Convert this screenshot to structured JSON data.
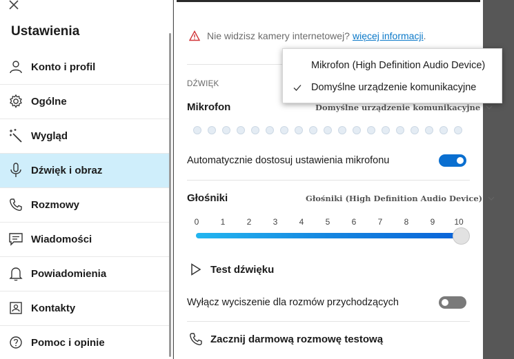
{
  "sidebar": {
    "title": "Ustawienia",
    "items": [
      {
        "label": "Konto i profil",
        "icon": "person-icon"
      },
      {
        "label": "Ogólne",
        "icon": "gear-icon"
      },
      {
        "label": "Wygląd",
        "icon": "magic-wand-icon"
      },
      {
        "label": "Dźwięk i obraz",
        "icon": "microphone-icon",
        "selected": true
      },
      {
        "label": "Rozmowy",
        "icon": "phone-icon"
      },
      {
        "label": "Wiadomości",
        "icon": "chat-icon"
      },
      {
        "label": "Powiadomienia",
        "icon": "bell-icon"
      },
      {
        "label": "Kontakty",
        "icon": "contact-card-icon"
      },
      {
        "label": "Pomoc i opinie",
        "icon": "help-icon"
      }
    ]
  },
  "camera": {
    "warning_text": "Nie widzisz kamery internetowej?",
    "link_text": "więcej informacji",
    "link_suffix": "."
  },
  "audio": {
    "section_label": "DŹWIĘK",
    "microphone": {
      "title": "Mikrofon",
      "selected": "Domyślne urządzenie komunikacyjne",
      "level_dots": 19
    },
    "auto_adjust": {
      "label": "Automatycznie dostosuj ustawienia mikrofonu",
      "enabled": true
    },
    "speakers": {
      "title": "Głośniki",
      "selected": "Głośniki (High Definition Audio Device)",
      "scale": [
        "0",
        "1",
        "2",
        "3",
        "4",
        "5",
        "6",
        "7",
        "8",
        "9",
        "10"
      ],
      "volume": 10,
      "volume_max": 10
    },
    "test_sound": "Test dźwięku",
    "mute_incoming": {
      "label": "Wyłącz wyciszenie dla rozmów przychodzących",
      "enabled": false
    },
    "test_call": "Zacznij darmową rozmowę testową"
  },
  "popup": {
    "options": [
      {
        "label": "Mikrofon (High Definition Audio Device)",
        "checked": false
      },
      {
        "label": "Domyślne urządzenie komunikacyjne",
        "checked": true
      }
    ]
  },
  "colors": {
    "accent": "#0a6fd0",
    "selected_nav": "#cfeefb",
    "link": "#0a78c8",
    "warning": "#d13438"
  }
}
